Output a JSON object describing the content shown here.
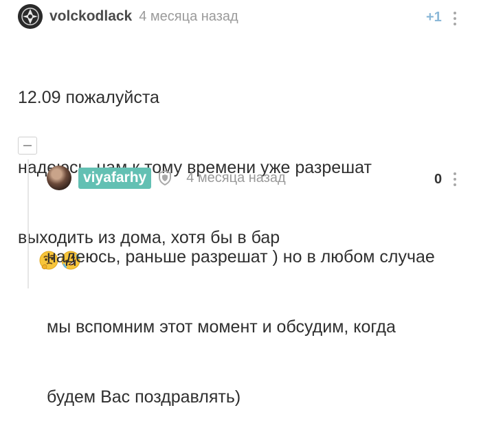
{
  "comment": {
    "username": "volckodlack",
    "date": "4 месяца назад",
    "rating": "+1",
    "lines": [
      "12.09 пожалуйста",
      "надеюсь, нам к тому времени уже разрешат",
      "выходить из дома, хотя бы в бар"
    ],
    "emojis": [
      "thinking-face",
      "rolling-on-floor-laughing"
    ]
  },
  "reply": {
    "username": "viyafarhy",
    "date": "4 месяца назад",
    "rating": "0",
    "lines": [
      "надеюсь, раньше разрешат ) но в любом случае",
      "мы вспомним этот момент и обсудим, когда",
      "будем Вас поздравлять)"
    ]
  },
  "colors": {
    "badge": "#63c0b3",
    "rating_positive": "#8bb8d8",
    "muted_text": "#9a9a9a"
  },
  "icons": {
    "verified": "shield-icon",
    "more": "more-vertical-icon",
    "collapse": "minus-icon"
  }
}
